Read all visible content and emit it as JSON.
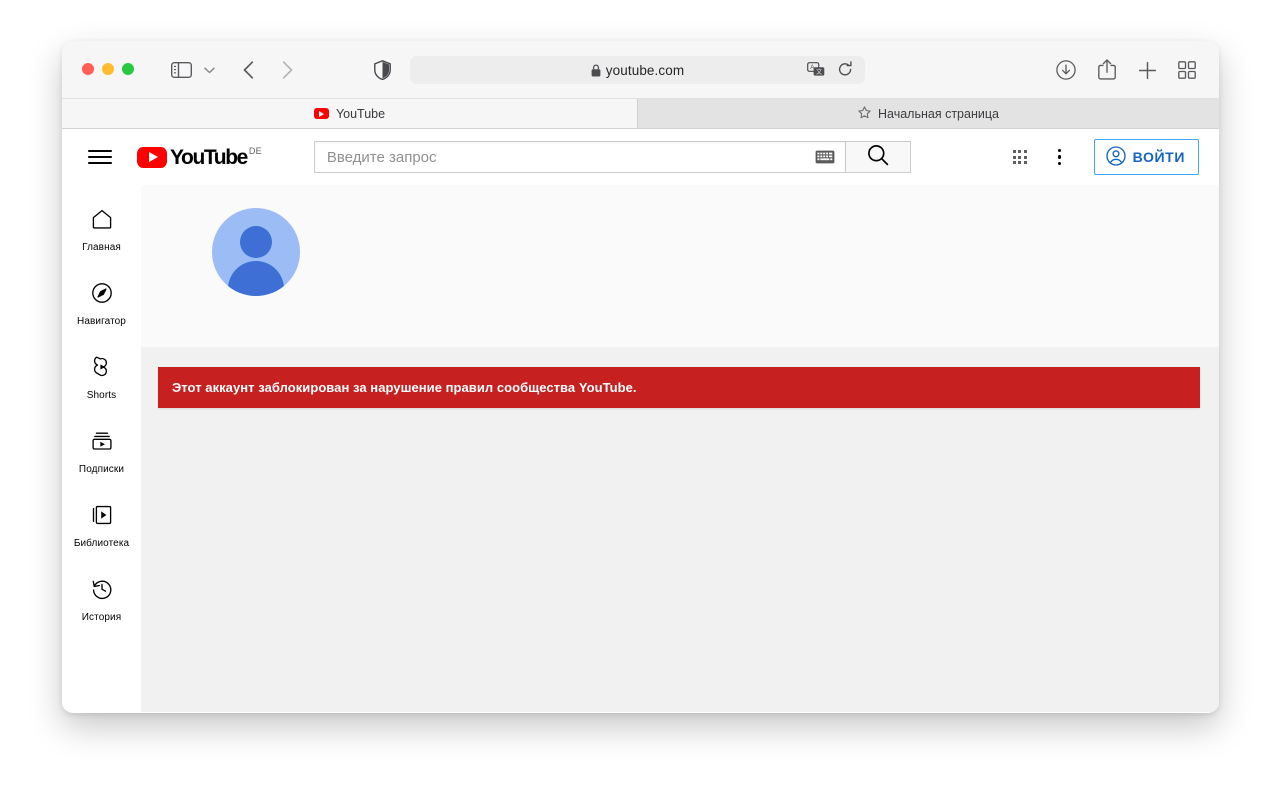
{
  "browser": {
    "traffic_lights": [
      "close",
      "minimize",
      "maximize"
    ],
    "address": {
      "url": "youtube.com",
      "lock_icon": "lock-icon",
      "translate_icon": "translate-icon",
      "reload_icon": "reload-icon"
    },
    "toolbar_icons": [
      "sidebar-toggle-icon",
      "chevron-down-icon",
      "back-arrow-icon",
      "forward-arrow-icon",
      "shield-privacy-icon",
      "download-icon",
      "share-icon",
      "new-tab-icon",
      "tab-overview-icon"
    ],
    "tabs": [
      {
        "label": "YouTube",
        "icon": "youtube-icon",
        "active": true
      },
      {
        "label": "Начальная страница",
        "icon": "star-icon",
        "active": false
      }
    ]
  },
  "youtube": {
    "logo": {
      "wordmark": "YouTube",
      "country_code": "DE",
      "icon": "youtube-play-icon"
    },
    "menu_icon": "hamburger-menu-icon",
    "search": {
      "placeholder": "Введите запрос",
      "value": "",
      "keyboard_icon": "keyboard-icon",
      "search_icon": "search-icon"
    },
    "header_actions": {
      "apps_icon": "apps-grid-icon",
      "more_icon": "more-vertical-icon",
      "signin_label": "ВОЙТИ",
      "signin_icon": "account-circle-icon"
    },
    "sidebar": [
      {
        "label": "Главная",
        "icon": "home-icon"
      },
      {
        "label": "Навигатор",
        "icon": "compass-icon"
      },
      {
        "label": "Shorts",
        "icon": "shorts-icon"
      },
      {
        "label": "Подписки",
        "icon": "subscriptions-icon"
      },
      {
        "label": "Библиотека",
        "icon": "library-icon"
      },
      {
        "label": "История",
        "icon": "history-icon"
      }
    ],
    "channel": {
      "avatar_icon": "default-account-avatar"
    },
    "banner": {
      "text": "Этот аккаунт заблокирован за нарушение правил сообщества YouTube.",
      "color": "#c62020"
    }
  }
}
